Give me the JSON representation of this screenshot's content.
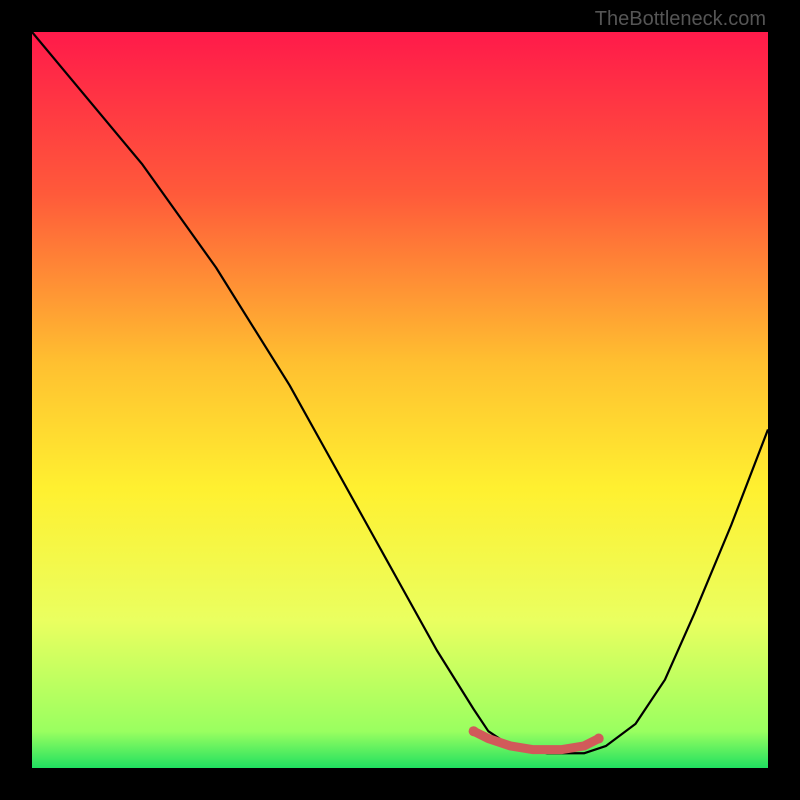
{
  "watermark": "TheBottleneck.com",
  "chart_data": {
    "type": "line",
    "title": "",
    "xlabel": "",
    "ylabel": "",
    "xlim": [
      0,
      100
    ],
    "ylim": [
      0,
      100
    ],
    "gradient_stops": [
      {
        "offset": 0,
        "color": "#ff1a4a"
      },
      {
        "offset": 22,
        "color": "#ff5a3a"
      },
      {
        "offset": 45,
        "color": "#ffc030"
      },
      {
        "offset": 62,
        "color": "#fff030"
      },
      {
        "offset": 80,
        "color": "#eaff60"
      },
      {
        "offset": 95,
        "color": "#9aff60"
      },
      {
        "offset": 100,
        "color": "#20e060"
      }
    ],
    "series": [
      {
        "name": "bottleneck-curve",
        "x": [
          0,
          5,
          10,
          15,
          20,
          25,
          30,
          35,
          40,
          45,
          50,
          55,
          60,
          62,
          65,
          70,
          75,
          78,
          82,
          86,
          90,
          95,
          100
        ],
        "values": [
          100,
          94,
          88,
          82,
          75,
          68,
          60,
          52,
          43,
          34,
          25,
          16,
          8,
          5,
          3,
          2,
          2,
          3,
          6,
          12,
          21,
          33,
          46
        ]
      }
    ],
    "highlight": {
      "name": "optimal-range",
      "color": "#d15a5a",
      "x": [
        60,
        62,
        65,
        68,
        72,
        75,
        77
      ],
      "values": [
        5,
        4,
        3,
        2.5,
        2.5,
        3,
        4
      ]
    }
  }
}
